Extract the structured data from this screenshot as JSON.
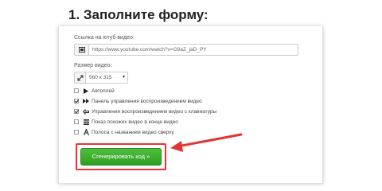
{
  "page_title": "1. Заполните форму:",
  "url_field": {
    "label": "Ссылка на ютуб видео:",
    "value": "https://www.youtube.com/watch?v=G9aZ_jaD_PY"
  },
  "size_field": {
    "label": "Размер видео:",
    "value": "560 x 315"
  },
  "options": [
    {
      "label": "Автоплей",
      "checked": false,
      "icon": "play-icon"
    },
    {
      "label": "Панель управления воспроизведением видео",
      "checked": true,
      "icon": "forward-icon"
    },
    {
      "label": "Управления воспроизведением видео с клавиатуры",
      "checked": true,
      "icon": "keyboard-hand-icon"
    },
    {
      "label": "Показ похожих видео в конце видео",
      "checked": false,
      "icon": "list-icon"
    },
    {
      "label": "Полоса с названием видео сверху",
      "checked": false,
      "icon": "font-icon"
    }
  ],
  "generate_button": {
    "label": "Сгенерировать код »"
  },
  "colors": {
    "button": "#3aa82c",
    "highlight": "#e33333"
  }
}
